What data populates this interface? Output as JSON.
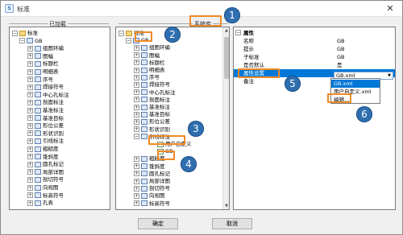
{
  "window": {
    "title": "标准",
    "icon": "app-icon",
    "close_label": "✕"
  },
  "groups": {
    "added_label": "已加载",
    "system_label": "系统库"
  },
  "left_tree": [
    {
      "label": "标准",
      "exp": "-"
    },
    {
      "label": "GB",
      "exp": "-"
    },
    {
      "label": "组图环编",
      "exp": "+"
    },
    {
      "label": "图幅",
      "exp": "+"
    },
    {
      "label": "标题栏",
      "exp": "+"
    },
    {
      "label": "明细表",
      "exp": "+"
    },
    {
      "label": "序号",
      "exp": "+"
    },
    {
      "label": "焊接符号",
      "exp": "+"
    },
    {
      "label": "中心孔标注",
      "exp": "+"
    },
    {
      "label": "剖面标注",
      "exp": "+"
    },
    {
      "label": "基准标注",
      "exp": "+"
    },
    {
      "label": "基准目标",
      "exp": "+"
    },
    {
      "label": "形位公差",
      "exp": "+"
    },
    {
      "label": "形状识别",
      "exp": "+"
    },
    {
      "label": "引线标注",
      "exp": "+"
    },
    {
      "label": "粗糙度",
      "exp": "+"
    },
    {
      "label": "锥斜度",
      "exp": "+"
    },
    {
      "label": "圆孔标记",
      "exp": "+"
    },
    {
      "label": "局部详图",
      "exp": "+"
    },
    {
      "label": "剖切符号",
      "exp": "+"
    },
    {
      "label": "向视图",
      "exp": "+"
    },
    {
      "label": "标高符号",
      "exp": "+"
    },
    {
      "label": "孔表",
      "exp": "+"
    }
  ],
  "mid_tree": [
    {
      "label": "标准",
      "exp": "-"
    },
    {
      "label": "GB",
      "exp": "-"
    },
    {
      "label": "组图环编",
      "exp": "+"
    },
    {
      "label": "图幅",
      "exp": "+"
    },
    {
      "label": "标题栏",
      "exp": "+"
    },
    {
      "label": "明细表",
      "exp": "+"
    },
    {
      "label": "序号",
      "exp": "+"
    },
    {
      "label": "焊接符号",
      "exp": "+"
    },
    {
      "label": "中心孔标注",
      "exp": "+"
    },
    {
      "label": "剖面标注",
      "exp": "+"
    },
    {
      "label": "基准标注",
      "exp": "+"
    },
    {
      "label": "基准目标",
      "exp": "+"
    },
    {
      "label": "形位公差",
      "exp": "+"
    },
    {
      "label": "形状识别",
      "exp": "+"
    },
    {
      "label": "引线标注",
      "exp": "-"
    },
    {
      "label": "用户自定义",
      "exp": ""
    },
    {
      "label": "GB",
      "exp": ""
    },
    {
      "label": "粗糙度",
      "exp": "+"
    },
    {
      "label": "锥斜度",
      "exp": "+"
    },
    {
      "label": "圆孔标记",
      "exp": "+"
    },
    {
      "label": "局部详图",
      "exp": "+"
    },
    {
      "label": "剖切符号",
      "exp": "+"
    },
    {
      "label": "向视图",
      "exp": "+"
    },
    {
      "label": "标高符号",
      "exp": "+"
    }
  ],
  "props": {
    "header": "属性",
    "rows": [
      {
        "name": "名称",
        "value": "GB"
      },
      {
        "name": "提示",
        "value": "GB"
      },
      {
        "name": "子标准",
        "value": "GB"
      },
      {
        "name": "是否默认",
        "value": "是"
      },
      {
        "name": "属性设置",
        "value": "GB.xml"
      },
      {
        "name": "备注",
        "value": ""
      }
    ]
  },
  "dropdown": [
    "GB.xml",
    "用户自定义.xml",
    "编辑..."
  ],
  "buttons": {
    "ok": "确定",
    "cancel": "取消"
  },
  "callouts": [
    "1",
    "2",
    "3",
    "4",
    "5",
    "6"
  ],
  "colors": {
    "callout": "#2f6fb0",
    "highlight": "#f08a24",
    "selection": "#0078d7"
  }
}
